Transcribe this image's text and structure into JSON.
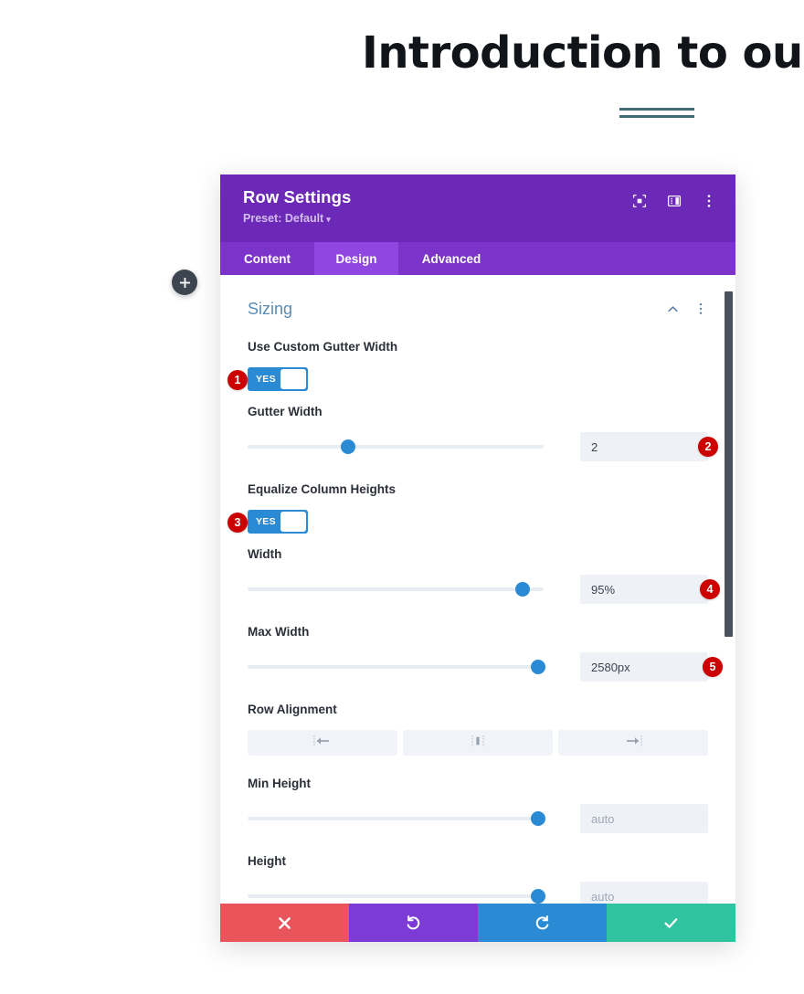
{
  "page": {
    "heading": "Introduction to our c",
    "divider_color": "#3f6d73"
  },
  "add_button": {
    "icon": "plus-icon",
    "label": "+"
  },
  "modal": {
    "title": "Row Settings",
    "preset_label": "Preset: Default",
    "preset_caret": "▾",
    "header_color": "#6c28b7",
    "header_icons": [
      {
        "name": "focus-target-icon"
      },
      {
        "name": "layout-panel-icon"
      },
      {
        "name": "more-vertical-icon"
      }
    ],
    "tabs": [
      {
        "label": "Content",
        "active": false
      },
      {
        "label": "Design",
        "active": true
      },
      {
        "label": "Advanced",
        "active": false
      }
    ],
    "section": {
      "title": "Sizing",
      "collapse_icon": "chevron-up-icon",
      "menu_icon": "more-vertical-icon"
    },
    "fields": {
      "use_custom_gutter_width": {
        "label": "Use Custom Gutter Width",
        "toggle_value": "YES",
        "badge": "1"
      },
      "gutter_width": {
        "label": "Gutter Width",
        "value": "2",
        "slider_percent": 34,
        "badge": "2"
      },
      "equalize_column_heights": {
        "label": "Equalize Column Heights",
        "toggle_value": "YES",
        "badge": "3"
      },
      "width": {
        "label": "Width",
        "value": "95%",
        "slider_percent": 93,
        "badge": "4"
      },
      "max_width": {
        "label": "Max Width",
        "value": "2580px",
        "slider_percent": 98,
        "badge": "5"
      },
      "row_alignment": {
        "label": "Row Alignment",
        "options": [
          {
            "name": "align-left-icon"
          },
          {
            "name": "align-center-icon"
          },
          {
            "name": "align-right-icon"
          }
        ]
      },
      "min_height": {
        "label": "Min Height",
        "placeholder": "auto",
        "slider_percent": 98
      },
      "height": {
        "label": "Height",
        "placeholder": "auto",
        "slider_percent": 98
      }
    },
    "footer": [
      {
        "name": "cancel-button",
        "icon": "close-icon",
        "color": "#e9555a"
      },
      {
        "name": "undo-button",
        "icon": "undo-icon",
        "color": "#7b3bd4"
      },
      {
        "name": "redo-button",
        "icon": "redo-icon",
        "color": "#2a8bd4"
      },
      {
        "name": "save-button",
        "icon": "check-icon",
        "color": "#2fc3a0"
      }
    ]
  }
}
